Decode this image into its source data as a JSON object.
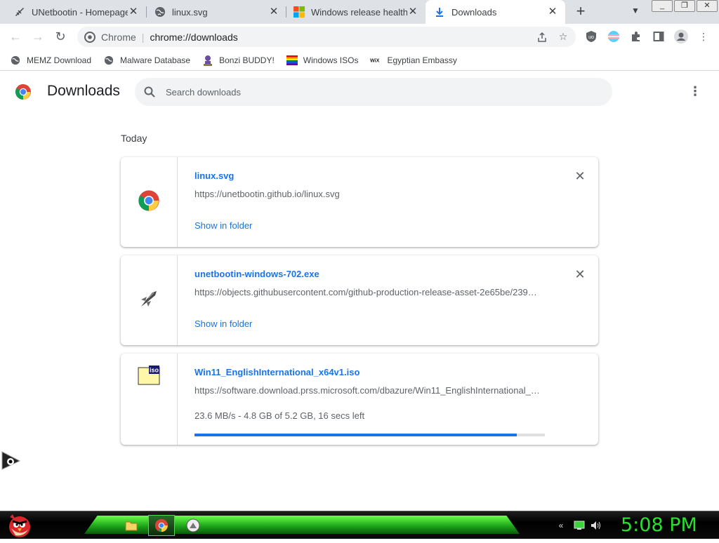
{
  "browser": {
    "tabs": [
      {
        "title": "UNetbootin - Homepage",
        "icon": "unetbootin-icon",
        "close": "✕"
      },
      {
        "title": "linux.svg",
        "icon": "globe-icon",
        "close": "✕"
      },
      {
        "title": "Windows release health | ",
        "icon": "microsoft-icon",
        "close": "✕"
      },
      {
        "title": "Downloads",
        "icon": "download-icon",
        "close": "✕",
        "active": true
      }
    ],
    "omnibox": {
      "scheme": "Chrome",
      "divider": "|",
      "url": "chrome://downloads"
    },
    "bookmarks": [
      {
        "label": "MEMZ Download",
        "icon": "globe-icon"
      },
      {
        "label": "Malware Database",
        "icon": "globe-icon"
      },
      {
        "label": "Bonzi BUDDY!",
        "icon": "bonzi-icon"
      },
      {
        "label": "Windows ISOs",
        "icon": "rainbow-flag-icon"
      },
      {
        "label": "Egyptian Embassy",
        "icon": "wix-icon"
      }
    ]
  },
  "downloads": {
    "title": "Downloads",
    "search_placeholder": "Search downloads",
    "day_label": "Today",
    "items": [
      {
        "filename": "linux.svg",
        "url": "https://unetbootin.github.io/linux.svg",
        "action": "Show in folder",
        "icon": "chrome-icon"
      },
      {
        "filename": "unetbootin-windows-702.exe",
        "url": "https://objects.githubusercontent.com/github-production-release-asset-2e65be/239…",
        "action": "Show in folder",
        "icon": "rocket-icon"
      },
      {
        "filename": "Win11_EnglishInternational_x64v1.iso",
        "url": "https://software.download.prss.microsoft.com/dbazure/Win11_EnglishInternational_…",
        "status": "23.6 MB/s - 4.8 GB of 5.2 GB, 16 secs left",
        "progress_percent": 92,
        "icon": "iso-file-icon"
      }
    ]
  },
  "taskbar": {
    "clock": "5:08 PM",
    "colors": {
      "accent": "#29e02f",
      "glow": "#1ea81a"
    }
  },
  "colors": {
    "link": "#1a73e8",
    "tabstrip": "#dee1e6",
    "omnibox": "#f1f3f4"
  }
}
